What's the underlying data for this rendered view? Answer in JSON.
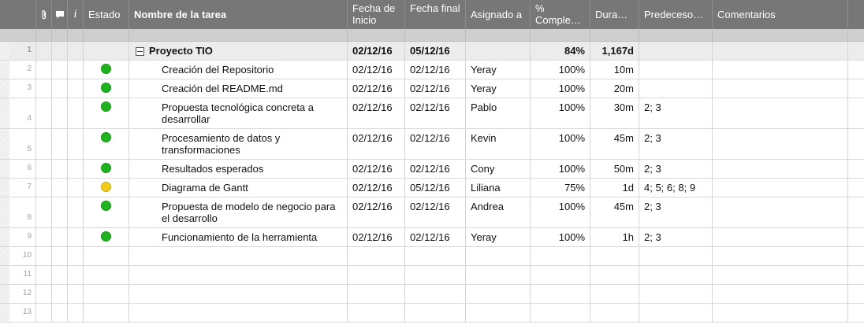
{
  "columns": {
    "estado": "Estado",
    "nombre": "Nombre de la tarea",
    "fecha_inicio": "Fecha de Inicio",
    "fecha_final": "Fecha final",
    "asignado": "Asignado a",
    "completado": "% Comple…",
    "duracion": "Dura…",
    "predecesoras": "Predeceso…",
    "comentarios": "Comentarios",
    "info_glyph": "i"
  },
  "icons": {
    "attachment": "paperclip-icon",
    "comment": "comment-icon",
    "info": "info-icon",
    "collapse": "collapse-minus-icon"
  },
  "status_colors": {
    "green": "#1fb41f",
    "yellow": "#f1cc1a"
  },
  "rows": [
    {
      "num": "1",
      "parent": true,
      "status": "",
      "name": "Proyecto TIO",
      "start": "02/12/16",
      "end": "05/12/16",
      "assigned": "",
      "pct": "84%",
      "dur": "1,167d",
      "pred": "",
      "comment": ""
    },
    {
      "num": "2",
      "parent": false,
      "status": "green",
      "name": "Creación del Repositorio",
      "start": "02/12/16",
      "end": "02/12/16",
      "assigned": "Yeray",
      "pct": "100%",
      "dur": "10m",
      "pred": "",
      "comment": ""
    },
    {
      "num": "3",
      "parent": false,
      "status": "green",
      "name": "Creación del README.md",
      "start": "02/12/16",
      "end": "02/12/16",
      "assigned": "Yeray",
      "pct": "100%",
      "dur": "20m",
      "pred": "",
      "comment": ""
    },
    {
      "num": "4",
      "parent": false,
      "status": "green",
      "name": "Propuesta tecnológica concreta a desarrollar",
      "start": "02/12/16",
      "end": "02/12/16",
      "assigned": "Pablo",
      "pct": "100%",
      "dur": "30m",
      "pred": "2; 3",
      "comment": ""
    },
    {
      "num": "5",
      "parent": false,
      "status": "green",
      "name": "Procesamiento de datos y transformaciones",
      "start": "02/12/16",
      "end": "02/12/16",
      "assigned": "Kevin",
      "pct": "100%",
      "dur": "45m",
      "pred": "2; 3",
      "comment": ""
    },
    {
      "num": "6",
      "parent": false,
      "status": "green",
      "name": "Resultados esperados",
      "start": "02/12/16",
      "end": "02/12/16",
      "assigned": "Cony",
      "pct": "100%",
      "dur": "50m",
      "pred": "2; 3",
      "comment": ""
    },
    {
      "num": "7",
      "parent": false,
      "status": "yellow",
      "name": "Diagrama de Gantt",
      "start": "02/12/16",
      "end": "05/12/16",
      "assigned": "Liliana",
      "pct": "75%",
      "dur": "1d",
      "pred": "4; 5; 6; 8; 9",
      "comment": ""
    },
    {
      "num": "8",
      "parent": false,
      "status": "green",
      "name": "Propuesta de modelo de negocio para el desarrollo",
      "start": "02/12/16",
      "end": "02/12/16",
      "assigned": "Andrea",
      "pct": "100%",
      "dur": "45m",
      "pred": "2; 3",
      "comment": ""
    },
    {
      "num": "9",
      "parent": false,
      "status": "green",
      "name": "Funcionamiento de la herramienta",
      "start": "02/12/16",
      "end": "02/12/16",
      "assigned": "Yeray",
      "pct": "100%",
      "dur": "1h",
      "pred": "2; 3",
      "comment": ""
    },
    {
      "num": "10",
      "parent": false,
      "status": "",
      "name": "",
      "start": "",
      "end": "",
      "assigned": "",
      "pct": "",
      "dur": "",
      "pred": "",
      "comment": ""
    },
    {
      "num": "11",
      "parent": false,
      "status": "",
      "name": "",
      "start": "",
      "end": "",
      "assigned": "",
      "pct": "",
      "dur": "",
      "pred": "",
      "comment": ""
    },
    {
      "num": "12",
      "parent": false,
      "status": "",
      "name": "",
      "start": "",
      "end": "",
      "assigned": "",
      "pct": "",
      "dur": "",
      "pred": "",
      "comment": ""
    },
    {
      "num": "13",
      "parent": false,
      "status": "",
      "name": "",
      "start": "",
      "end": "",
      "assigned": "",
      "pct": "",
      "dur": "",
      "pred": "",
      "comment": ""
    }
  ]
}
